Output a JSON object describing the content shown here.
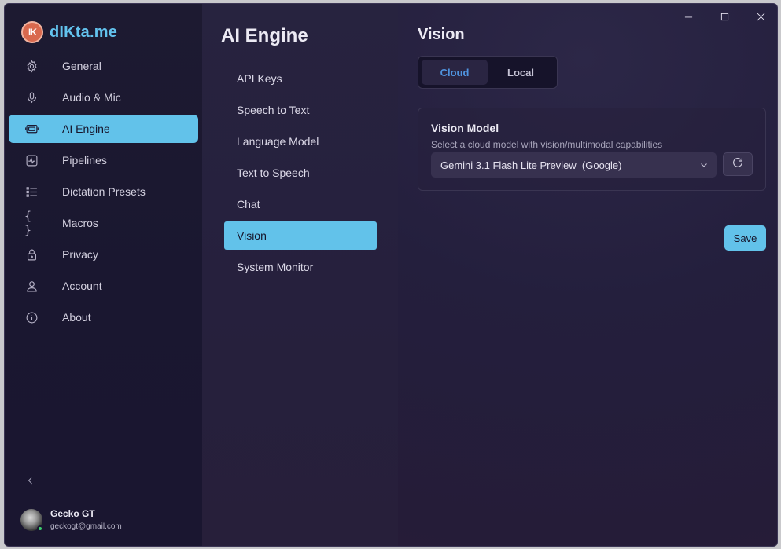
{
  "app": {
    "name": "dIKta.me",
    "logo_text": "IK"
  },
  "sidebar": {
    "items": [
      {
        "label": "General",
        "icon": "gear-icon"
      },
      {
        "label": "Audio & Mic",
        "icon": "microphone-icon"
      },
      {
        "label": "AI Engine",
        "icon": "chip-icon",
        "active": true
      },
      {
        "label": "Pipelines",
        "icon": "pulse-icon"
      },
      {
        "label": "Dictation Presets",
        "icon": "list-icon"
      },
      {
        "label": "Macros",
        "icon": "braces-icon"
      },
      {
        "label": "Privacy",
        "icon": "lock-icon"
      },
      {
        "label": "Account",
        "icon": "user-icon"
      },
      {
        "label": "About",
        "icon": "info-icon"
      }
    ],
    "accent": "#62c2ea"
  },
  "user": {
    "name": "Gecko GT",
    "email": "geckogt@gmail.com",
    "status_color": "#3ccf6e"
  },
  "subnav": {
    "title": "AI Engine",
    "items": [
      {
        "label": "API Keys"
      },
      {
        "label": "Speech to Text"
      },
      {
        "label": "Language Model"
      },
      {
        "label": "Text to Speech"
      },
      {
        "label": "Chat"
      },
      {
        "label": "Vision",
        "active": true
      },
      {
        "label": "System Monitor"
      }
    ]
  },
  "content": {
    "title": "Vision",
    "tabs": [
      {
        "label": "Cloud",
        "active": true
      },
      {
        "label": "Local"
      }
    ],
    "card": {
      "title": "Vision Model",
      "description": "Select a cloud model with vision/multimodal capabilities",
      "selected_model": "Gemini 3.1 Flash Lite Preview  (Google)"
    },
    "save_label": "Save"
  }
}
